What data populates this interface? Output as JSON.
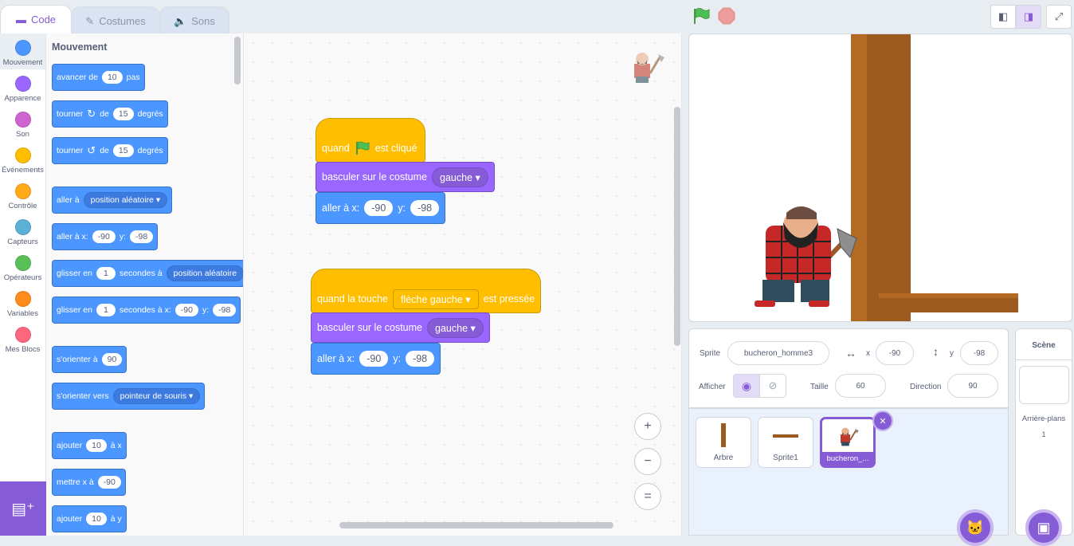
{
  "tabs": [
    {
      "label": "Code"
    },
    {
      "label": "Costumes"
    },
    {
      "label": "Sons"
    }
  ],
  "categories": [
    {
      "label": "Mouvement",
      "color": "#4c97ff"
    },
    {
      "label": "Apparence",
      "color": "#9966ff"
    },
    {
      "label": "Son",
      "color": "#cf63cf"
    },
    {
      "label": "Événements",
      "color": "#ffbf00"
    },
    {
      "label": "Contrôle",
      "color": "#ffab19"
    },
    {
      "label": "Capteurs",
      "color": "#5cb1d6"
    },
    {
      "label": "Opérateurs",
      "color": "#59c059"
    },
    {
      "label": "Variables",
      "color": "#ff8c1a"
    },
    {
      "label": "Mes Blocs",
      "color": "#ff6680"
    }
  ],
  "palette": {
    "title": "Mouvement",
    "move": {
      "a": "avancer de",
      "v": "10",
      "b": "pas"
    },
    "turn_right": {
      "a": "tourner",
      "b": "de",
      "v": "15",
      "c": "degrés"
    },
    "turn_left": {
      "a": "tourner",
      "b": "de",
      "v": "15",
      "c": "degrés"
    },
    "goto": {
      "a": "aller à",
      "dd": "position aléatoire"
    },
    "goto_xy": {
      "a": "aller à x:",
      "x": "-90",
      "b": "y:",
      "y": "-98"
    },
    "glide": {
      "a": "glisser en",
      "v": "1",
      "b": "secondes à",
      "dd": "position aléatoire"
    },
    "glide_xy": {
      "a": "glisser en",
      "v": "1",
      "b": "secondes à x:",
      "x": "-90",
      "c": "y:",
      "y": "-98"
    },
    "point": {
      "a": "s'orienter à",
      "v": "90"
    },
    "point_towards": {
      "a": "s'orienter vers",
      "dd": "pointeur de souris"
    },
    "change_x": {
      "a": "ajouter",
      "v": "10",
      "b": "à x"
    },
    "set_x": {
      "a": "mettre x à",
      "v": "-90"
    },
    "change_y": {
      "a": "ajouter",
      "v": "10",
      "b": "à y"
    }
  },
  "script1": {
    "hat_a": "quand",
    "hat_b": "est cliqué",
    "costume_label": "basculer sur le costume",
    "costume": "gauche",
    "goto_a": "aller à x:",
    "x": "-90",
    "goto_b": "y:",
    "y": "-98"
  },
  "script2": {
    "hat_a": "quand la touche",
    "key": "flèche gauche",
    "hat_b": "est pressée",
    "costume_label": "basculer sur le costume",
    "costume": "gauche",
    "goto_a": "aller à x:",
    "x": "-90",
    "goto_b": "y:",
    "y": "-98"
  },
  "zoom": {
    "in": "+",
    "out": "−",
    "reset": "="
  },
  "sprite_info": {
    "sprite_label": "Sprite",
    "sprite_name": "bucheron_homme3",
    "x_label": "x",
    "x": "-90",
    "y_label": "y",
    "y": "-98",
    "show_label": "Afficher",
    "size_label": "Taille",
    "size": "60",
    "direction_label": "Direction",
    "direction": "90"
  },
  "sprites": [
    {
      "name": "Arbre"
    },
    {
      "name": "Sprite1"
    },
    {
      "name": "bucheron_..."
    }
  ],
  "scene": {
    "title": "Scène",
    "backdrops_label": "Arrière-plans",
    "backdrops_count": "1"
  },
  "colors": {
    "accent": "#855cd6",
    "motion": "#4c97ff",
    "looks": "#9966ff",
    "events": "#ffbf00"
  }
}
